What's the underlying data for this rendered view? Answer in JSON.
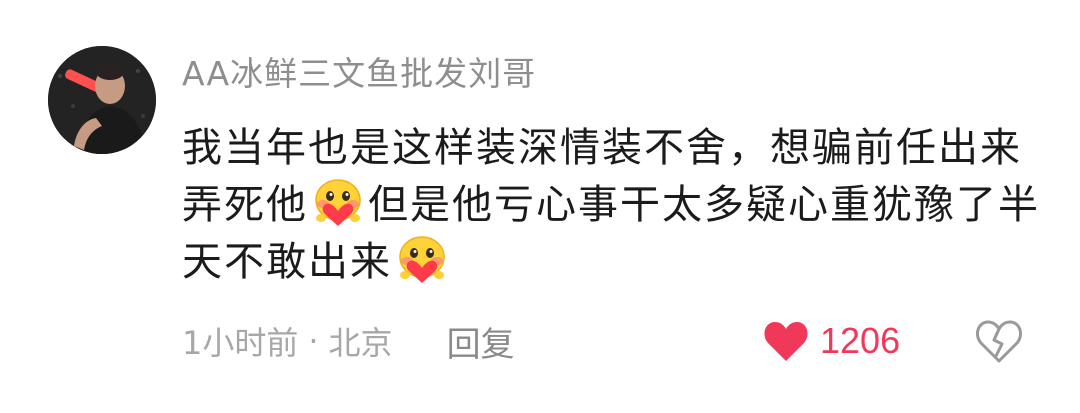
{
  "comment": {
    "username": "AA冰鲜三文鱼批发刘哥",
    "text_part1": "我当年也是这样装深情装不舍，想骗前任出来弄死他",
    "text_part2": "但是他亏心事干太多疑心重犹豫了半天不敢出来",
    "time": "1小时前",
    "separator": "·",
    "location": "北京",
    "reply_label": "回复",
    "like_count": "1206"
  },
  "icons": {
    "avatar": "user-avatar-photo",
    "emoji": "blush-heart-emoji",
    "like": "heart-filled-icon",
    "dislike": "broken-heart-icon"
  },
  "colors": {
    "username": "#8e8e8e",
    "text": "#1b1b1b",
    "meta": "#a7a7a7",
    "like": "#f0395a",
    "dislike_outline": "#9a9a9a"
  }
}
